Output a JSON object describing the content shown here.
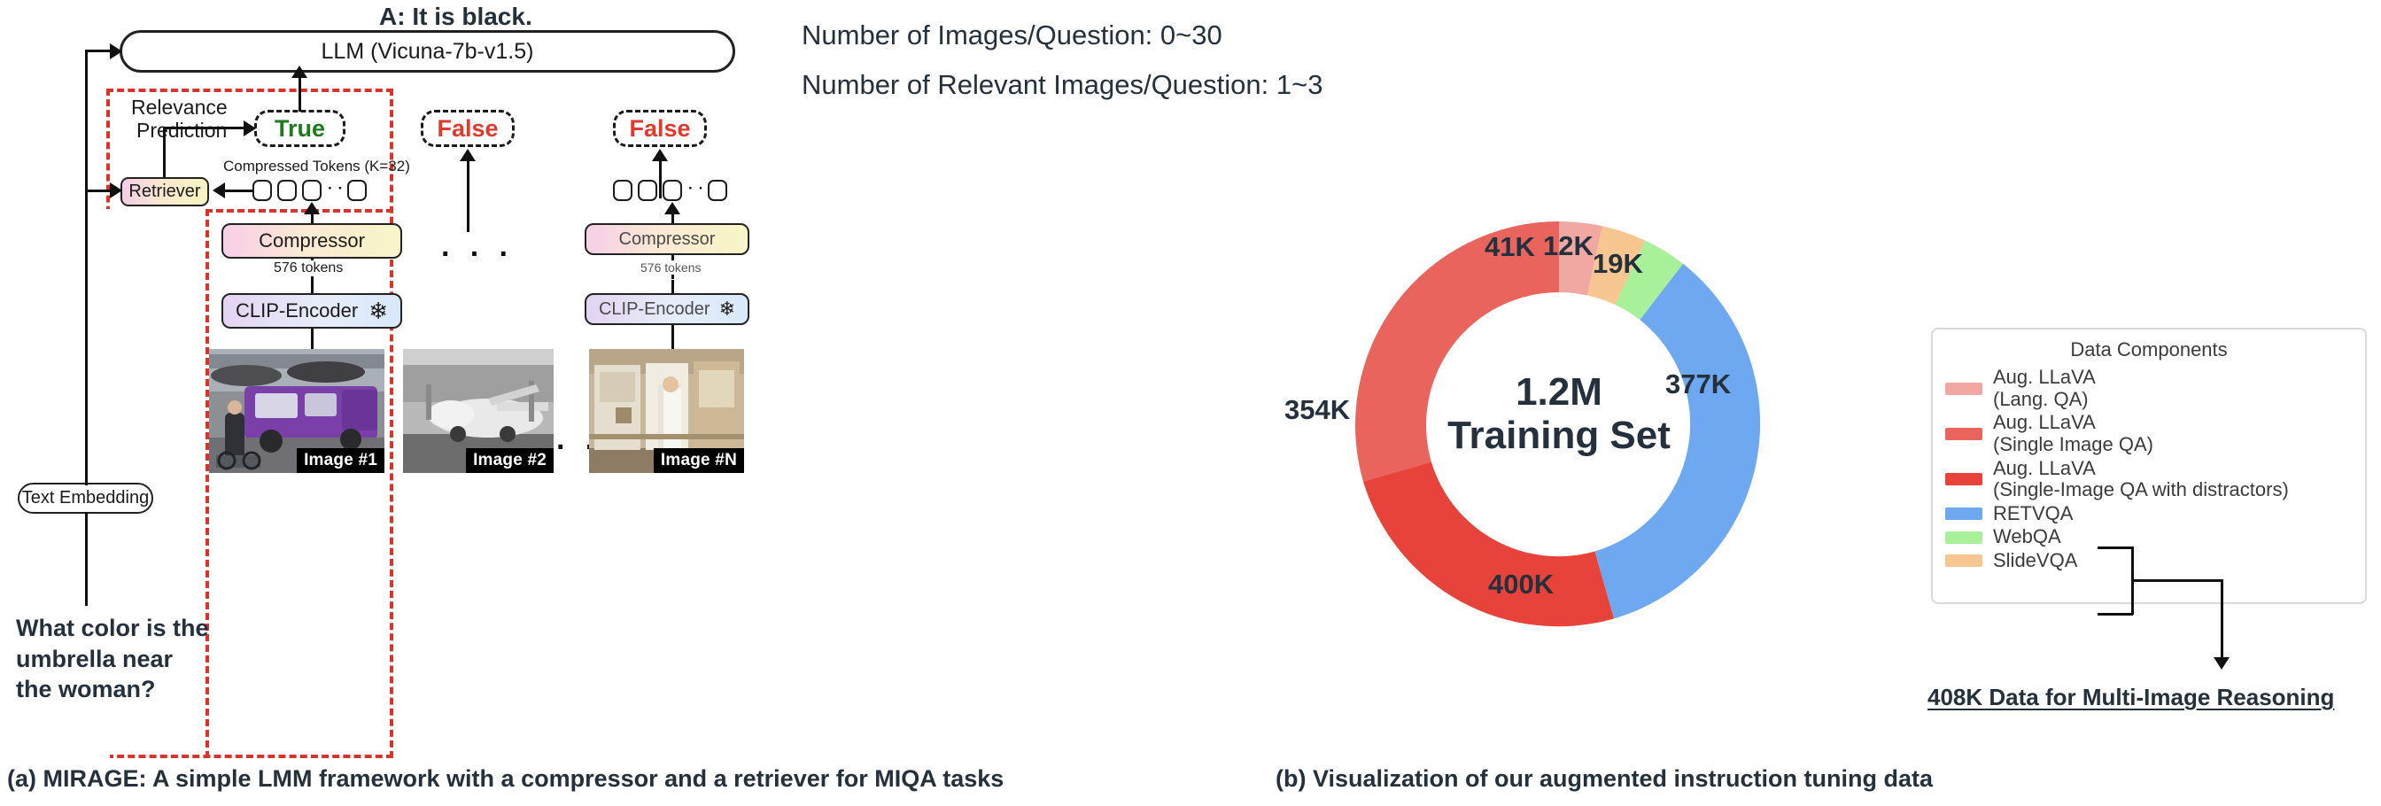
{
  "answer": {
    "text": "A: It is black."
  },
  "llm": {
    "label": "LLM (Vicuna-7b-v1.5)"
  },
  "relevance": {
    "title_line1": "Relevance",
    "title_line2": "Prediction"
  },
  "predictions": [
    {
      "label": "True",
      "color": "#1f7a1f"
    },
    {
      "label": "False",
      "color": "#e03a2f"
    },
    {
      "label": "False",
      "color": "#e03a2f"
    }
  ],
  "compressed_tokens_label": "Compressed Tokens (K=32)",
  "retriever": {
    "label": "Retriever"
  },
  "text_embedding": {
    "label": "Text Embedding"
  },
  "question": {
    "line1": "What color is the",
    "line2": "umbrella near",
    "line3": "the woman?"
  },
  "columns": [
    {
      "compressor": "Compressor",
      "tokens_note": "576 tokens",
      "encoder": "CLIP-Encoder",
      "frozen_icon": "snowflake-icon",
      "image_caption": "Image #1"
    },
    {
      "compressor": "",
      "tokens_note": "",
      "encoder": "",
      "frozen_icon": "",
      "image_caption": "Image #2"
    },
    {
      "compressor": "Compressor",
      "tokens_note": "576 tokens",
      "encoder": "CLIP-Encoder",
      "frozen_icon": "snowflake-icon",
      "image_caption": "Image #N"
    }
  ],
  "ellipsis": "· · ·",
  "stats": {
    "line1": "Number of Images/Question: 0~30",
    "line2": "Number of Relevant Images/Question: 1~3"
  },
  "chart_data": {
    "type": "pie",
    "title": "1.2M Training Set",
    "center_line1": "1.2M",
    "center_line2": "Training Set",
    "total_label": "1.2M",
    "categories": [
      "Aug. LLaVA\n(Single Image QA)",
      "Aug. LLaVA\n(Lang. QA)",
      "SlideVQA",
      "WebQA",
      "RETVQA",
      "Aug. LLaVA\n(Single-Image QA with distractors)"
    ],
    "values": [
      354,
      41,
      12,
      19,
      377,
      400
    ],
    "value_labels": [
      "354K",
      "41K",
      "12K",
      "19K",
      "377K",
      "400K"
    ],
    "colors": [
      "#e8645c",
      "#f2a8a2",
      "#f7c691",
      "#a8f09a",
      "#6ea8f0",
      "#e8433a"
    ],
    "legend": {
      "title": "Data Components",
      "position": "right",
      "entries": [
        {
          "label": "Aug. LLaVA\n(Lang. QA)",
          "color": "#f2a8a2"
        },
        {
          "label": "Aug. LLaVA\n(Single Image QA)",
          "color": "#e8645c"
        },
        {
          "label": "Aug. LLaVA\n(Single-Image QA with distractors)",
          "color": "#e8433a"
        },
        {
          "label": "RETVQA",
          "color": "#6ea8f0"
        },
        {
          "label": "WebQA",
          "color": "#a8f09a"
        },
        {
          "label": "SlideVQA",
          "color": "#f7c691"
        }
      ]
    },
    "annotation": "408K Data for Multi-Image Reasoning"
  },
  "captions": {
    "a": "(a) MIRAGE: A simple LMM framework with a compressor and a retriever for MIQA tasks",
    "b": "(b) Visualization of our augmented instruction tuning data"
  }
}
